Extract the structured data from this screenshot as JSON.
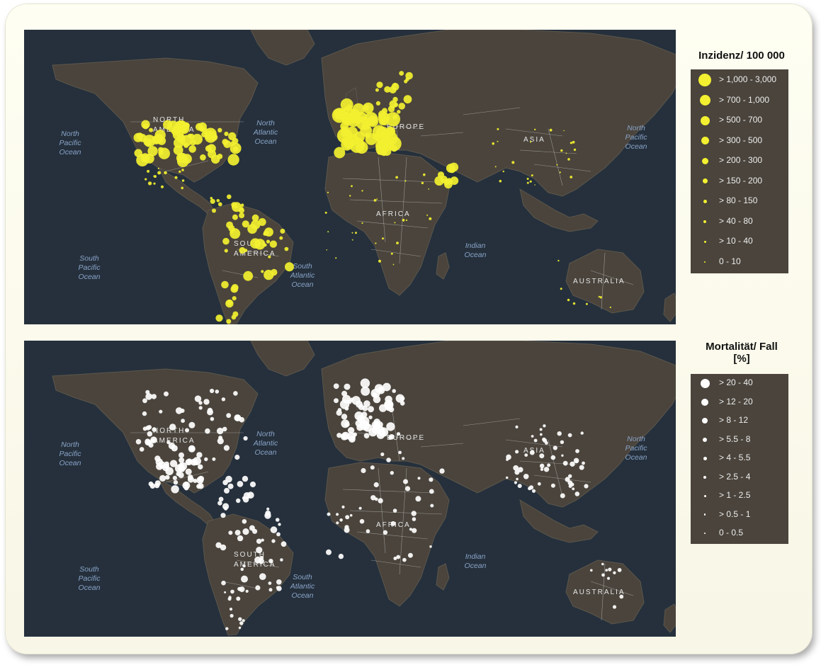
{
  "maps": [
    {
      "id": "incidence",
      "legend_title": "Inzidenz/ 100 000",
      "dot_color": "#f2f030",
      "legend_items": [
        "> 1,000 - 3,000",
        "> 700 - 1,000",
        "> 500 - 700",
        "> 300 - 500",
        "> 200 - 300",
        "> 150 - 200",
        "> 80 - 150",
        "> 40 - 80",
        "> 10 - 40",
        "0 - 10"
      ]
    },
    {
      "id": "mortality",
      "legend_title_lines": [
        "Mortalität/ Fall",
        "[%]"
      ],
      "dot_color": "#ffffff",
      "legend_items": [
        "> 20 - 40",
        "> 12 - 20",
        "> 8 - 12",
        "> 5.5 - 8",
        "> 4 - 5.5",
        "> 2.5 - 4",
        "> 1 - 2.5",
        "> 0.5 - 1",
        "0 - 0.5"
      ]
    }
  ],
  "region_labels": {
    "north_america": "NORTH AMERICA",
    "south_america": "SOUTH AMERICA",
    "europe": "EUROPE",
    "africa": "AFRICA",
    "asia": "ASIA",
    "australia": "AUSTRALIA"
  },
  "ocean_labels": {
    "north_pacific": [
      "North",
      "Pacific",
      "Ocean"
    ],
    "south_pacific": [
      "South",
      "Pacific",
      "Ocean"
    ],
    "north_atlantic": [
      "North",
      "Atlantic",
      "Ocean"
    ],
    "south_atlantic": [
      "South",
      "Atlantic",
      "Ocean"
    ],
    "indian": [
      "Indian",
      "Ocean"
    ],
    "north_pacific_east": [
      "North",
      "Pacific",
      "Ocean"
    ]
  },
  "colors": {
    "ocean": "#25303c",
    "land": "#4a443c",
    "border": "#d8d8d8",
    "ocean_label": "#8aa4c8",
    "region_label": "#e6e6e6",
    "legend_bg": "#4a443c"
  }
}
